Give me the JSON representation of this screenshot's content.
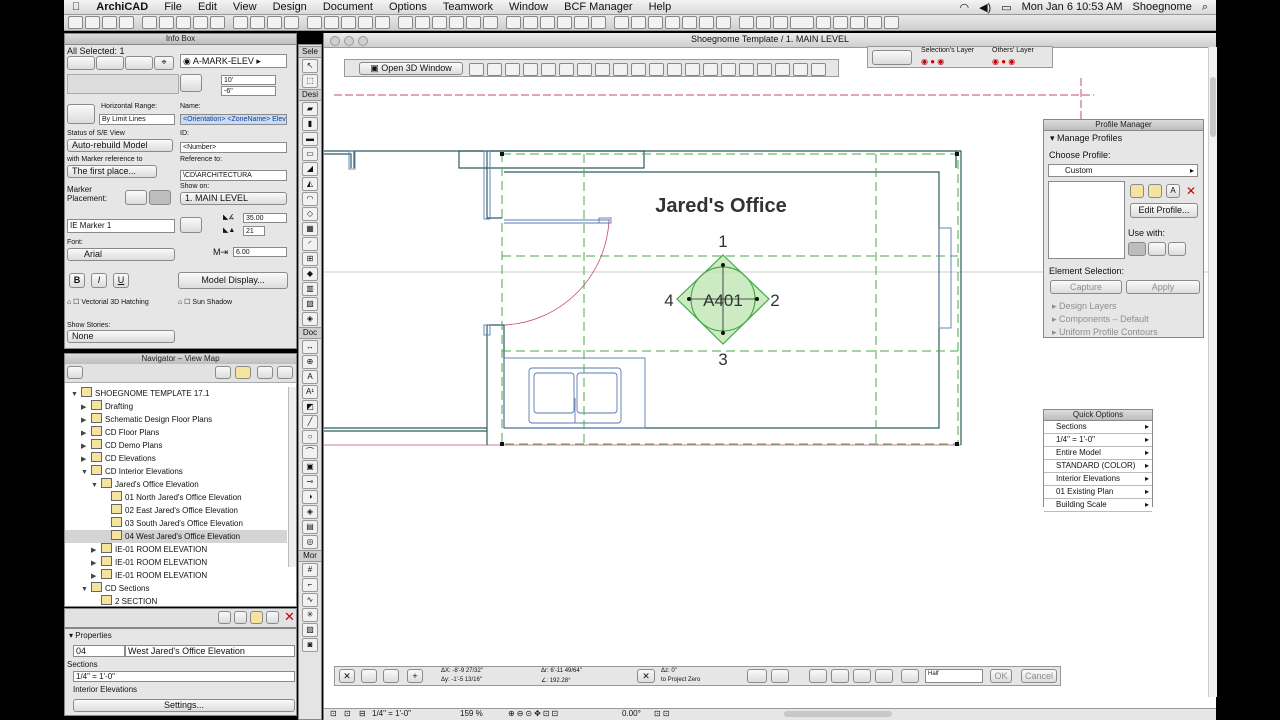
{
  "menubar": {
    "app": "ArchiCAD",
    "items": [
      "File",
      "Edit",
      "View",
      "Design",
      "Document",
      "Options",
      "Teamwork",
      "Window",
      "BCF Manager",
      "Help"
    ],
    "clock": "Mon Jan 6  10:53 AM",
    "user": "Shoegnome"
  },
  "window": {
    "title": "Shoegnome Template / 1. MAIN LEVEL"
  },
  "infobox": {
    "title": "Info Box",
    "all_selected": "All Selected: 1",
    "marker_name": "A-MARK-ELEV",
    "size_a": "10'",
    "size_b": "-6\"",
    "horizontal_range_label": "Horizontal Range:",
    "horizontal_range_value": "By Limit Lines",
    "name_label": "Name:",
    "name_value": "<Orientation> <ZoneName> Elevat",
    "status_label": "Status of S/E View",
    "status_value": "Auto-rebuild Model",
    "id_label": "ID:",
    "id_value": "<Number>",
    "marker_ref_label": "with Marker reference to",
    "marker_ref_value": "The first place...",
    "reference_label": "Reference to:",
    "reference_value": "\\CD\\ARCHITECTURA",
    "marker_placement_label": "Marker Placement:",
    "show_on_label": "Show on:",
    "show_on_value": "1. MAIN LEVEL",
    "marker_type": "IE Marker 1",
    "angle_value": "35.00",
    "pen_value": "21",
    "font_label": "Font:",
    "font_value": "Arial",
    "font_size": "6.00",
    "bold": "B",
    "italic": "I",
    "underline": "U",
    "model_display": "Model Display...",
    "vectorial_hatching": "Vectorial 3D Hatching",
    "sun_shadow": "Sun Shadow",
    "show_stories_label": "Show Stories:",
    "show_stories_value": "None"
  },
  "navigator": {
    "title": "Navigator – View Map",
    "items": [
      {
        "label": "SHOEGNOME TEMPLATE 17.1",
        "level": 0,
        "expanded": true
      },
      {
        "label": "Drafting",
        "level": 1,
        "expanded": false
      },
      {
        "label": "Schematic Design Floor Plans",
        "level": 1,
        "expanded": false
      },
      {
        "label": "CD Floor Plans",
        "level": 1,
        "expanded": false
      },
      {
        "label": "CD Demo Plans",
        "level": 1,
        "expanded": false
      },
      {
        "label": "CD Elevations",
        "level": 1,
        "expanded": false
      },
      {
        "label": "CD Interior Elevations",
        "level": 1,
        "expanded": true
      },
      {
        "label": "Jared's Office Elevation",
        "level": 2,
        "expanded": true
      },
      {
        "label": "01 North Jared's Office Elevation",
        "level": 3
      },
      {
        "label": "02 East Jared's Office Elevation",
        "level": 3
      },
      {
        "label": "03 South Jared's Office Elevation",
        "level": 3
      },
      {
        "label": "04 West Jared's Office Elevation",
        "level": 3,
        "selected": true
      },
      {
        "label": "IE-01     ROOM ELEVATION",
        "level": 2,
        "expanded": false
      },
      {
        "label": "IE-01     ROOM ELEVATION",
        "level": 2,
        "expanded": false
      },
      {
        "label": "IE-01     ROOM ELEVATION",
        "level": 2,
        "expanded": false
      },
      {
        "label": "CD Sections",
        "level": 1,
        "expanded": true
      },
      {
        "label": "2 SECTION",
        "level": 2
      }
    ]
  },
  "properties": {
    "title": "Properties",
    "id": "04",
    "name": "West Jared's Office Elevation",
    "row1": "Sections",
    "row2": "1/4\"  =  1'-0\"",
    "row3": "Interior Elevations",
    "settings": "Settings..."
  },
  "toolbox": {
    "sections": [
      "Sele",
      "Desi",
      "Doc",
      "Mor"
    ]
  },
  "plan": {
    "open3d": "Open 3D Window",
    "room_name": "Jared's Office",
    "marker_id": "A401",
    "n1": "1",
    "n2": "2",
    "n3": "3",
    "n4": "4"
  },
  "layers": {
    "selection": "Selection's Layer",
    "others": "Others' Layer"
  },
  "profile_manager": {
    "title": "Profile Manager",
    "manage": "Manage Profiles",
    "choose": "Choose Profile:",
    "profile": "Custom",
    "edit": "Edit Profile...",
    "use_with": "Use with:",
    "element_selection": "Element Selection:",
    "capture": "Capture",
    "apply": "Apply",
    "design_layers": "Design Layers",
    "components": "Components – Default",
    "contours": "Uniform Profile Contours"
  },
  "quick_options": {
    "title": "Quick Options",
    "rows": [
      "Sections",
      "1/4\"   =    1'-0\"",
      "Entire Model",
      "STANDARD (COLOR)",
      "Interior Elevations",
      "01 Existing Plan",
      "Building Scale"
    ]
  },
  "coords": {
    "dx": "ΔX: -8'-9 27/32\"",
    "dy": "Δy: -1'-5 13/16\"",
    "dr": "Δr: 6'-11 49/64\"",
    "da": "∠: 192.28°",
    "dz": "Δz: 0\"",
    "zero": "to Project Zero",
    "half": "Half",
    "ok": "OK",
    "cancel": "Cancel"
  },
  "statusbar": {
    "scale": "1/4\"   =   1'-0\"",
    "zoom": "159 %",
    "angle": "0.00°"
  },
  "colors": {
    "green": "#4aa84a",
    "selection": "#ff0000",
    "pink": "#c04a7a",
    "blue": "#5a7ab0"
  }
}
